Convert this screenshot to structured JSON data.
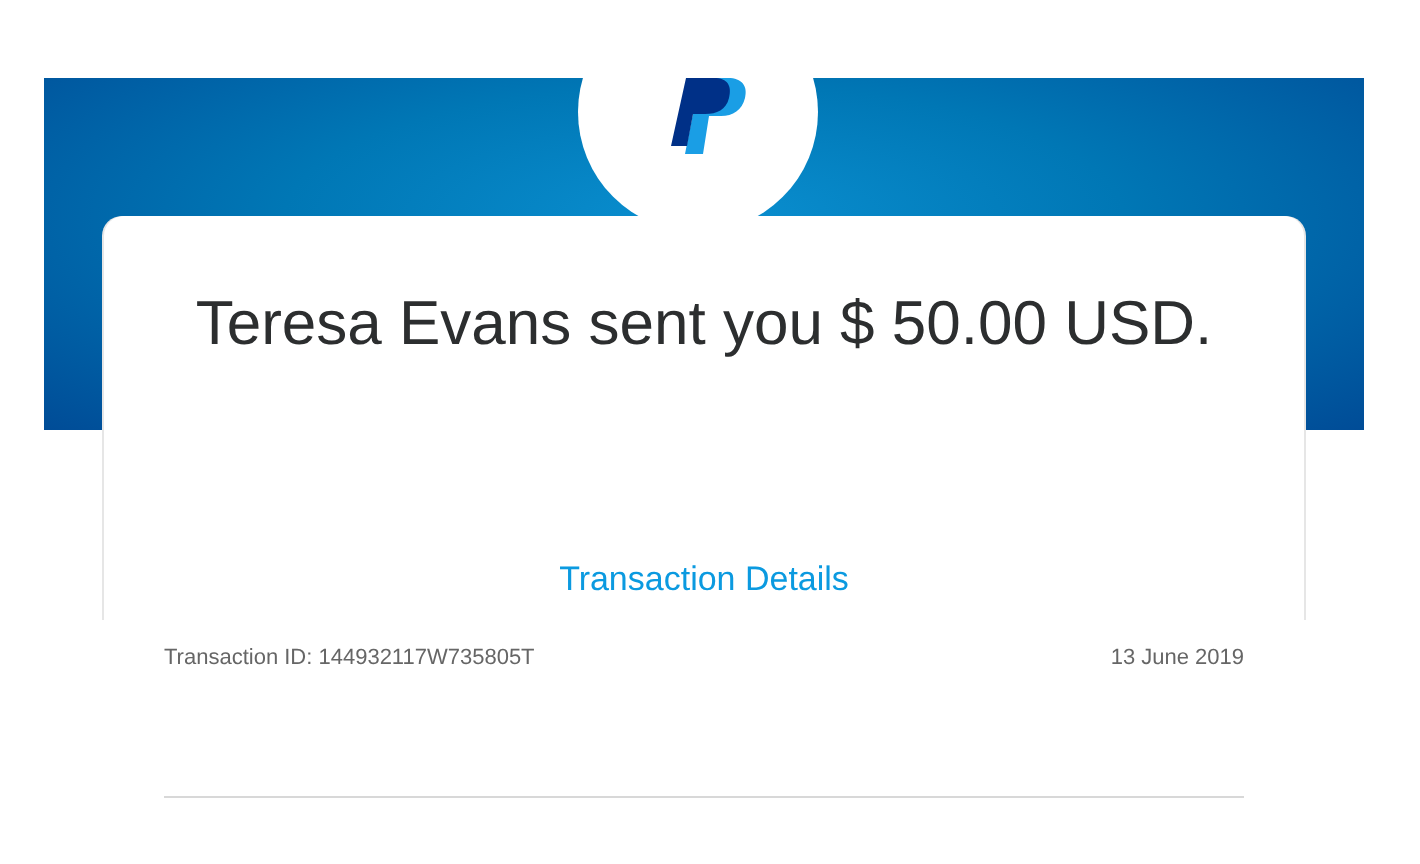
{
  "message": {
    "headline": "Teresa Evans sent you $ 50.00 USD."
  },
  "details_link": "Transaction Details",
  "transaction": {
    "id_text": "Transaction ID: 144932117W735805T",
    "date": "13 June 2019"
  }
}
